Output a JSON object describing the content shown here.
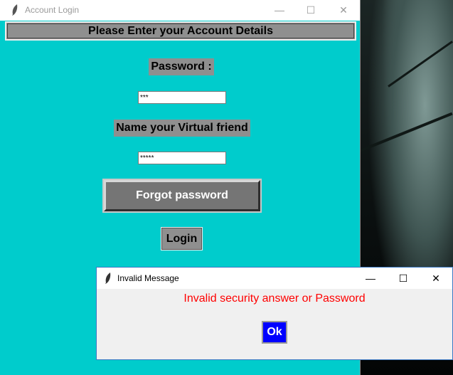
{
  "main_window": {
    "title": "Account Login",
    "controls": {
      "minimize": "—",
      "maximize": "☐",
      "close": "✕"
    },
    "header": "Please Enter your Account Details",
    "password_label": "Password :",
    "password_value": "***",
    "friend_label": "Name your Virtual friend",
    "friend_value": "*****",
    "forgot_button": "Forgot password",
    "login_button": "Login"
  },
  "dialog": {
    "title": "Invalid Message",
    "controls": {
      "minimize": "—",
      "maximize": "☐",
      "close": "✕"
    },
    "message": "Invalid security answer or Password",
    "ok_button": "Ok"
  },
  "colors": {
    "window_bg": "#00cccc",
    "label_bg": "#8f8f8f",
    "error_text": "#ff0000",
    "ok_button_bg": "#0000ff"
  },
  "icons": [
    "feather-icon",
    "minimize-icon",
    "maximize-icon",
    "close-icon"
  ]
}
